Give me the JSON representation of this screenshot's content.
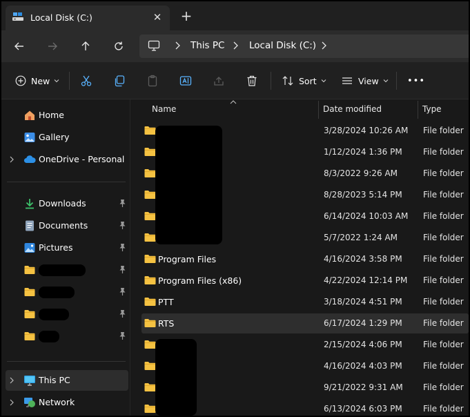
{
  "window": {
    "tab_title": "Local Disk (C:)",
    "new_tab_label": "+",
    "close_label": "✕"
  },
  "navigation": {
    "breadcrumb": [
      "This PC",
      "Local Disk (C:)"
    ]
  },
  "commands": {
    "new_label": "New",
    "sort_label": "Sort",
    "view_label": "View",
    "more_label": "•••"
  },
  "sidebar": {
    "top_items": [
      {
        "label": "Home",
        "icon": "home-icon"
      },
      {
        "label": "Gallery",
        "icon": "gallery-icon"
      },
      {
        "label": "OneDrive - Personal",
        "icon": "cloud-icon",
        "expandable": true
      }
    ],
    "quick_access": [
      {
        "label": "Downloads",
        "icon": "download-icon",
        "pinned": true
      },
      {
        "label": "Documents",
        "icon": "document-icon",
        "pinned": true
      },
      {
        "label": "Pictures",
        "icon": "pictures-icon",
        "pinned": true
      },
      {
        "label": "",
        "icon": "folder-icon",
        "pinned": true,
        "redacted": true
      },
      {
        "label": "",
        "icon": "folder-icon",
        "pinned": true,
        "redacted": true
      },
      {
        "label": "",
        "icon": "folder-icon",
        "pinned": true,
        "redacted": true
      },
      {
        "label": "",
        "icon": "folder-icon",
        "pinned": true,
        "redacted": true
      }
    ],
    "bottom_items": [
      {
        "label": "This PC",
        "icon": "computer-icon",
        "expandable": true,
        "active": true
      },
      {
        "label": "Network",
        "icon": "network-icon",
        "expandable": true
      }
    ]
  },
  "file_list": {
    "columns": {
      "name": "Name",
      "date": "Date modified",
      "type": "Type"
    },
    "rows": [
      {
        "name": "",
        "date": "3/28/2024 10:26 AM",
        "type": "File folder",
        "redacted": true
      },
      {
        "name": "",
        "date": "1/12/2024 1:36 PM",
        "type": "File folder",
        "redacted": true
      },
      {
        "name": "",
        "date": "8/3/2022 9:26 AM",
        "type": "File folder",
        "redacted": true
      },
      {
        "name": "",
        "date": "8/28/2023 5:14 PM",
        "type": "File folder",
        "redacted": true
      },
      {
        "name": "",
        "date": "6/14/2024 10:03 AM",
        "type": "File folder",
        "redacted": true
      },
      {
        "name": "",
        "date": "5/7/2022 1:24 AM",
        "type": "File folder",
        "redacted": true
      },
      {
        "name": "Program Files",
        "date": "4/16/2024 3:58 PM",
        "type": "File folder"
      },
      {
        "name": "Program Files (x86)",
        "date": "4/22/2024 12:14 PM",
        "type": "File folder"
      },
      {
        "name": "PTT",
        "date": "3/18/2024 4:51 PM",
        "type": "File folder"
      },
      {
        "name": "RTS",
        "date": "6/17/2024 1:29 PM",
        "type": "File folder",
        "selected": true
      },
      {
        "name": "",
        "date": "2/15/2024 4:06 PM",
        "type": "File folder",
        "redacted": true
      },
      {
        "name": "",
        "date": "4/16/2024 4:03 PM",
        "type": "File folder",
        "redacted": true
      },
      {
        "name": "",
        "date": "9/21/2022 9:31 AM",
        "type": "File folder",
        "redacted": true
      },
      {
        "name": "",
        "date": "6/13/2024 6:03 PM",
        "type": "File folder",
        "redacted": true
      }
    ]
  },
  "colors": {
    "folder": "#f5c242",
    "accent": "#4cc2ff",
    "selection": "#2e2e2e"
  }
}
